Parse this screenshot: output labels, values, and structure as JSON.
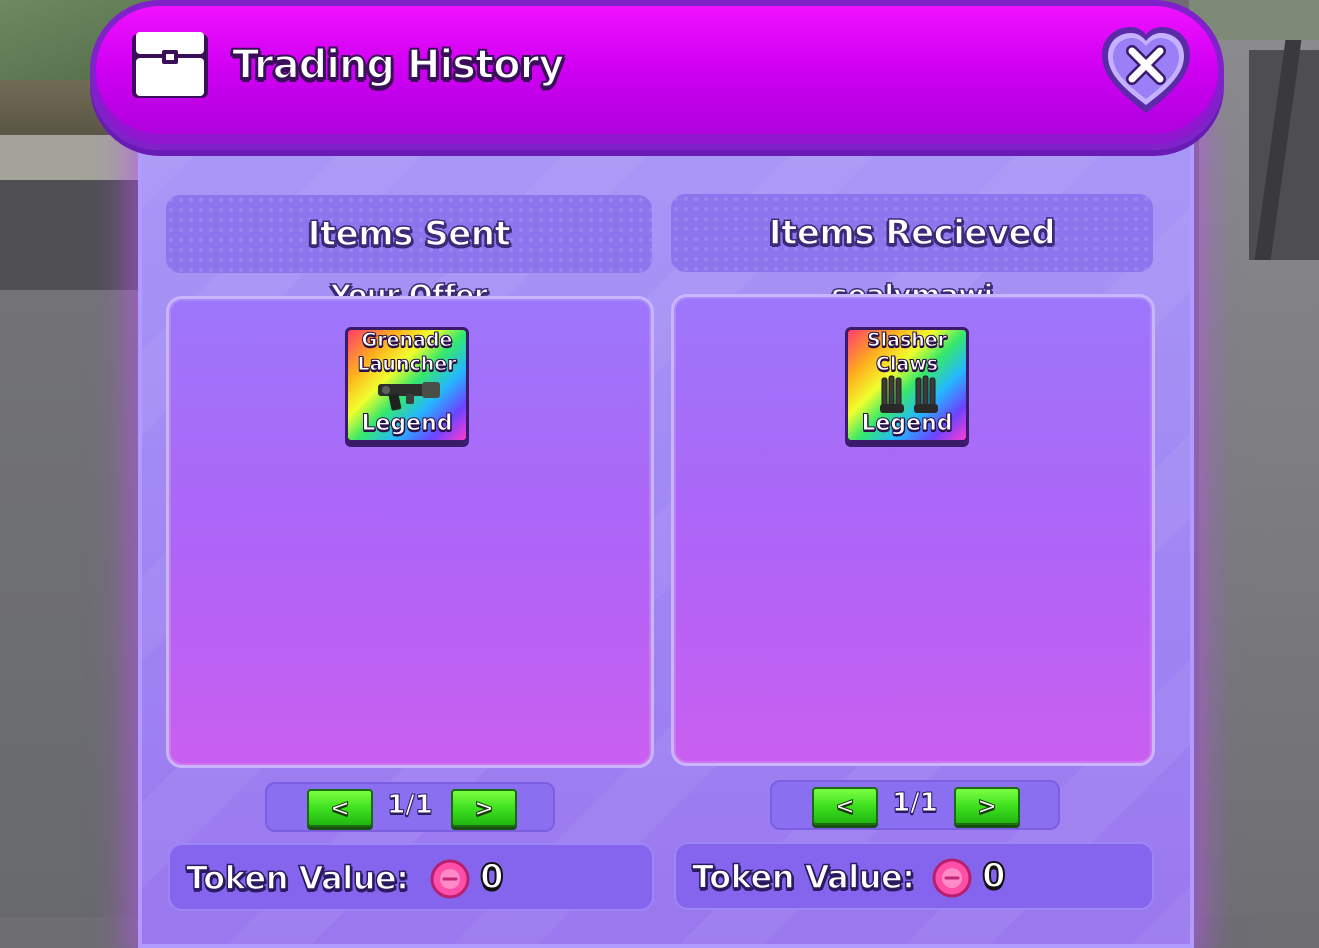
{
  "window": {
    "title": "Trading History",
    "close_icon": "close-heart-icon",
    "title_icon": "chest-icon"
  },
  "sent": {
    "heading": "Items Sent",
    "owner": "Your Offer",
    "items": [
      {
        "name": "Grenade Launcher",
        "rarity": "Legend"
      }
    ],
    "page": "1/1",
    "prev_label": "<",
    "next_label": ">",
    "token_label": "Token Value:",
    "token_value": "0"
  },
  "received": {
    "heading": "Items Recieved",
    "owner": "sealymawi",
    "items": [
      {
        "name": "Slasher Claws",
        "rarity": "Legend"
      }
    ],
    "page": "1/1",
    "prev_label": "<",
    "next_label": ">",
    "token_label": "Token Value:",
    "token_value": "0"
  },
  "colors": {
    "header": "#d000f2",
    "panel": "#a998f6",
    "button_green": "#3ee01f",
    "token_pink": "#ff4fa8"
  }
}
